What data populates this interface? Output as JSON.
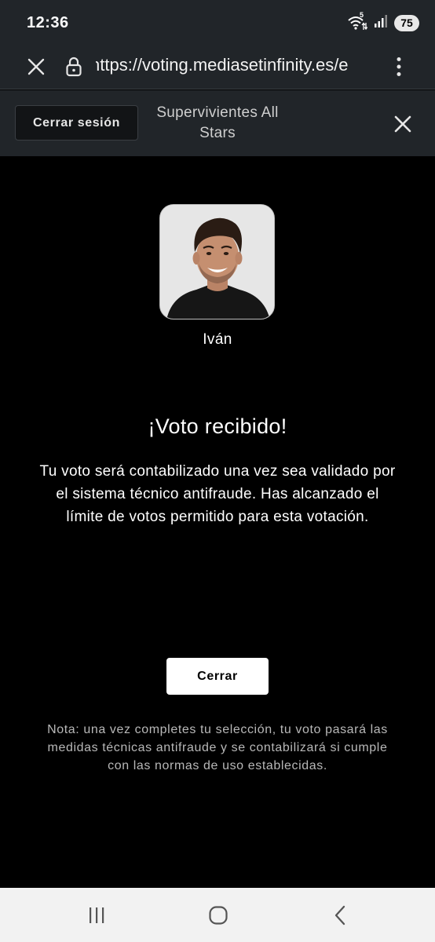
{
  "status_bar": {
    "time": "12:36",
    "battery": "75",
    "wifi_badge": "5",
    "icons": [
      "wifi-icon",
      "signal-icon",
      "battery-icon"
    ]
  },
  "browser": {
    "url": "https://voting.mediasetinfinity.es/e",
    "icons": [
      "close-tab-icon",
      "lock-icon",
      "more-menu-icon"
    ]
  },
  "site_header": {
    "signout_label": "Cerrar sesión",
    "title": "Supervivientes All Stars",
    "close_icon": "close-icon"
  },
  "vote": {
    "contestant_name": "Iván",
    "headline": "¡Voto recibido!",
    "message": "Tu voto será contabilizado una vez sea validado por el sistema técnico antifraude. Has alcanzado el límite de votos permitido para esta votación.",
    "close_label": "Cerrar",
    "note": "Nota: una vez completes tu selección, tu voto pasará las medidas técnicas antifraude y se contabilizará si cumple con las normas de uso establecidas."
  },
  "nav_bar": {
    "icons": [
      "recent-apps-icon",
      "home-icon",
      "back-icon"
    ]
  },
  "colors": {
    "page_background": "#000000",
    "chrome_background": "#212529",
    "button_background": "#ffffff",
    "nav_background": "#f2f2f2"
  }
}
